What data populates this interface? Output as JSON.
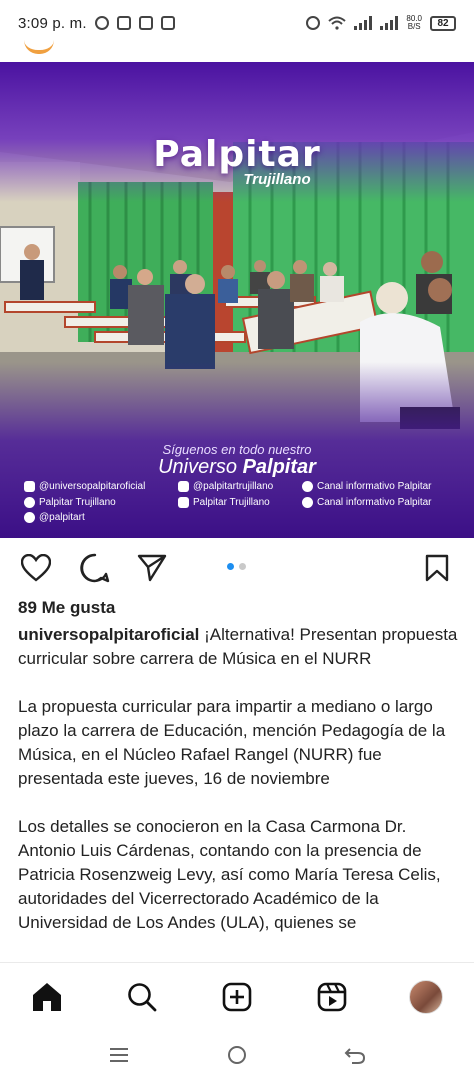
{
  "status_bar": {
    "time": "3:09 p. m.",
    "network_speed_value": "80.0",
    "network_speed_unit": "B/S",
    "battery": "82",
    "notification_icons": [
      "whatsapp-icon",
      "instagram-icon",
      "copy-icon",
      "news-icon"
    ],
    "system_icons": [
      "alarm-icon",
      "wifi-icon",
      "signal-icon",
      "signal-icon"
    ]
  },
  "post": {
    "image": {
      "brand_title": "Palpitar",
      "brand_subtitle": "Trujillano",
      "follow_text": "Síguenos en todo nuestro",
      "universe_text_1": "Universo",
      "universe_text_2": "Palpitar",
      "socials": {
        "instagram": "@universopalpitaroficial",
        "tiktok": "@palpitartrujillano",
        "whatsapp_channel": "Canal informativo Palpitar",
        "facebook": "Palpitar Trujillano",
        "youtube": "Palpitar Trujillano",
        "telegram": "Canal informativo Palpitar",
        "twitter": "@palpitart"
      },
      "carousel": {
        "total": 2,
        "active": 1
      }
    },
    "likes_text": "89 Me gusta",
    "username": "universopalpitaroficial",
    "caption_first": "¡Alternativa! Presentan propuesta curricular sobre carrera de Música en el NURR",
    "caption_paragraph_2": "La propuesta curricular para impartir a mediano o largo plazo la carrera de Educación, mención Pedagogía de la Música, en el Núcleo Rafael Rangel (NURR) fue presentada este jueves, 16 de noviembre",
    "caption_paragraph_3": "Los detalles se conocieron en la Casa Carmona Dr. Antonio Luis Cárdenas, contando con la presencia de Patricia Rosenzweig Levy, así como María Teresa Celis, autoridades del Vicerrectorado Académico de la Universidad de Los Andes (ULA), quienes se"
  },
  "bottom_nav": [
    "home-icon",
    "search-icon",
    "create-post-icon",
    "reels-icon",
    "profile-avatar"
  ],
  "system_nav": [
    "recents-icon",
    "home-circle-icon",
    "back-icon"
  ],
  "colors": {
    "accent_blue": "#1d8ef0",
    "brand_purple": "#5b1fa8",
    "icon_dark": "#222222"
  }
}
